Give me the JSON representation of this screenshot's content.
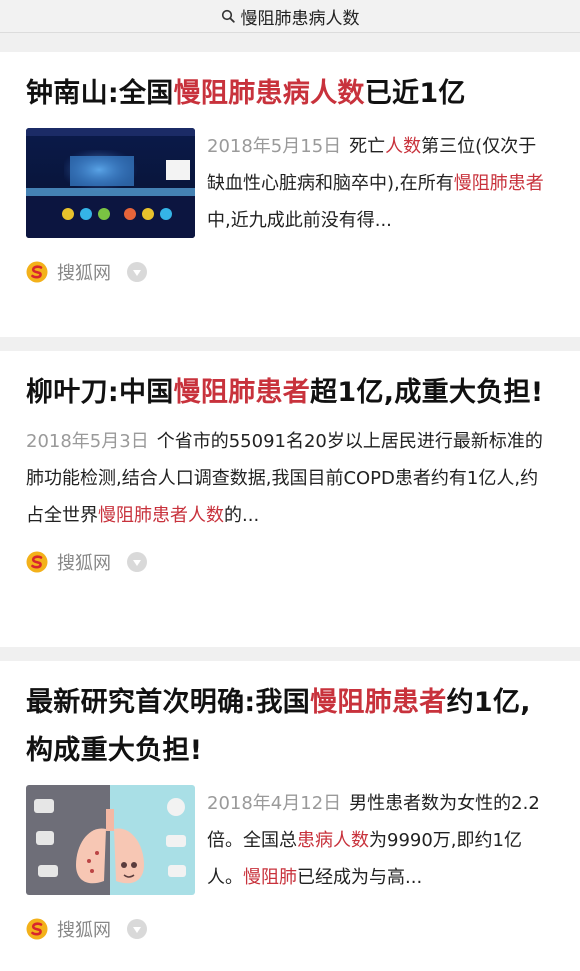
{
  "search": {
    "query": "慢阻肺患病人数"
  },
  "results": [
    {
      "title_parts": [
        {
          "text": "钟南山:全国",
          "hl": false
        },
        {
          "text": "慢阻肺患病人数",
          "hl": true
        },
        {
          "text": "已近1亿",
          "hl": false
        }
      ],
      "date": "2018年5月15日",
      "snippet_parts": [
        {
          "text": "死亡",
          "hl": false
        },
        {
          "text": "人数",
          "hl": true
        },
        {
          "text": "第三位(仅次于缺血性心脏病和脑卒中),在所有",
          "hl": false
        },
        {
          "text": "慢阻肺患者",
          "hl": true
        },
        {
          "text": "中,近九成此前没有得...",
          "hl": false
        }
      ],
      "source": "搜狐网",
      "has_thumb": true
    },
    {
      "title_parts": [
        {
          "text": "柳叶刀:中国",
          "hl": false
        },
        {
          "text": "慢阻肺患者",
          "hl": true
        },
        {
          "text": "超1亿,成重大负担!",
          "hl": false
        }
      ],
      "date": "2018年5月3日",
      "snippet_parts": [
        {
          "text": "个省市的55091名20岁以上居民进行最新标准的肺功能检测,结合人口调查数据,我国目前COPD患者约有1亿人,约占全世界",
          "hl": false
        },
        {
          "text": "慢阻肺患者人数",
          "hl": true
        },
        {
          "text": "的...",
          "hl": false
        }
      ],
      "source": "搜狐网",
      "has_thumb": false
    },
    {
      "title_parts": [
        {
          "text": "最新研究首次明确:我国",
          "hl": false
        },
        {
          "text": "慢阻肺患者",
          "hl": true
        },
        {
          "text": "约1亿,构成重大负担!",
          "hl": false
        }
      ],
      "date": "2018年4月12日",
      "snippet_parts": [
        {
          "text": "男性患者数为女性的2.2倍。全国总",
          "hl": false
        },
        {
          "text": "患病人数",
          "hl": true
        },
        {
          "text": "为9990万,即约1亿人。",
          "hl": false
        },
        {
          "text": "慢阻肺",
          "hl": true
        },
        {
          "text": "已经成为与高...",
          "hl": false
        }
      ],
      "source": "搜狐网",
      "has_thumb": true
    }
  ],
  "colors": {
    "highlight": "#c8323c",
    "date": "#9a9a9a",
    "background": "#f0f0f0"
  }
}
